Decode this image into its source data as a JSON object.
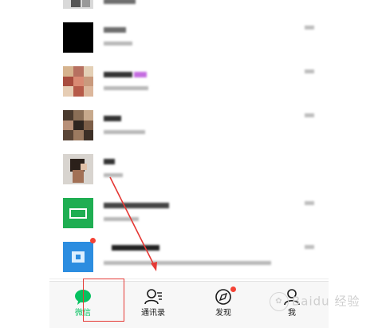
{
  "tabs": [
    {
      "label": "微信",
      "active": true
    },
    {
      "label": "通讯录",
      "active": false
    },
    {
      "label": "发现",
      "active": false
    },
    {
      "label": "我",
      "active": false
    }
  ],
  "watermark": "Baidu 经验",
  "colors": {
    "accent": "#07c160",
    "annotation": "#e53935",
    "badge": "#f44336"
  }
}
